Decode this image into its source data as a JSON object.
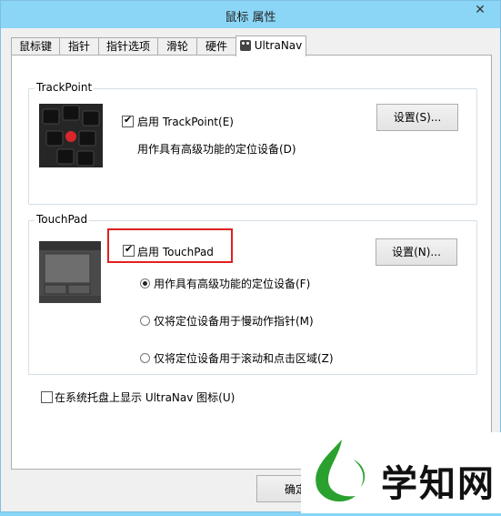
{
  "window": {
    "title": "鼠标 属性",
    "close": "✕"
  },
  "tabs": [
    {
      "label": "鼠标键"
    },
    {
      "label": "指针"
    },
    {
      "label": "指针选项"
    },
    {
      "label": "滑轮"
    },
    {
      "label": "硬件"
    },
    {
      "label": "UltraNav",
      "active": true
    }
  ],
  "trackpoint": {
    "group_label": "TrackPoint",
    "enable_label": "启用 TrackPoint(E)",
    "enable_checked": true,
    "settings_button": "设置(S)...",
    "description": "用作具有高级功能的定位设备(D)"
  },
  "touchpad": {
    "group_label": "TouchPad",
    "enable_label": "启用 TouchPad",
    "enable_checked": true,
    "settings_button": "设置(N)...",
    "options": [
      {
        "label": "用作具有高级功能的定位设备(F)",
        "selected": true
      },
      {
        "label": "仅将定位设备用于慢动作指针(M)",
        "selected": false
      },
      {
        "label": "仅将定位设备用于滚动和点击区域(Z)",
        "selected": false
      }
    ]
  },
  "tray": {
    "label": "在系统托盘上显示 UltraNav 图标(U)",
    "checked": false
  },
  "footer": {
    "ok_button": "确定"
  },
  "watermark": {
    "text": "学知网"
  },
  "colors": {
    "titlebar": "#8bd6f6",
    "highlight": "#e02020",
    "watermark_green": "#2aa12e"
  }
}
